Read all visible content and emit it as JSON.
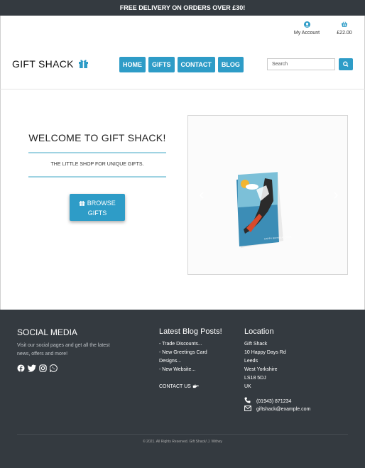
{
  "banner": {
    "text": "FREE DELIVERY ON ORDERS OVER £30!"
  },
  "header": {
    "account_label": "My Account",
    "cart_label": "£22.00",
    "brand": "GIFT SHACK",
    "nav": [
      "HOME",
      "GIFTS",
      "CONTACT",
      "BLOG"
    ],
    "search_placeholder": "Search"
  },
  "hero": {
    "title": "WELCOME TO GIFT SHACK!",
    "tagline": "THE LITTLE SHOP FOR UNIQUE GIFTS.",
    "button_line1": "BROWSE",
    "button_line2": "GIFTS",
    "card_text": "HAPPY BIRTHDAY DUDE"
  },
  "footer": {
    "social": {
      "heading": "SOCIAL MEDIA",
      "line1": "Visit our social pages and get all the latest",
      "line2": "news, offers and more!",
      "icons": [
        "facebook-icon",
        "twitter-icon",
        "instagram-icon",
        "whatsapp-icon"
      ]
    },
    "blog": {
      "heading": "Latest Blog Posts!",
      "posts": [
        "- Trade Discounts...",
        "- New Greetings Card",
        "Designs...",
        "- New Website..."
      ],
      "contact": "CONTACT US"
    },
    "location": {
      "heading": "Location",
      "address": [
        "Gift Shack",
        "10 Happy Days Rd",
        "Leeds",
        "West Yorkshire",
        "LS18 5DJ",
        "UK"
      ],
      "phone": "(01943) 871234",
      "email": "giftshack@example.com"
    },
    "copyright": "© 2021. All Rights Reserved. Gift Shack/ J. Withey"
  },
  "colors": {
    "accent": "#2e9cc7",
    "dark": "#343a40",
    "rule": "#9fd3e2"
  }
}
